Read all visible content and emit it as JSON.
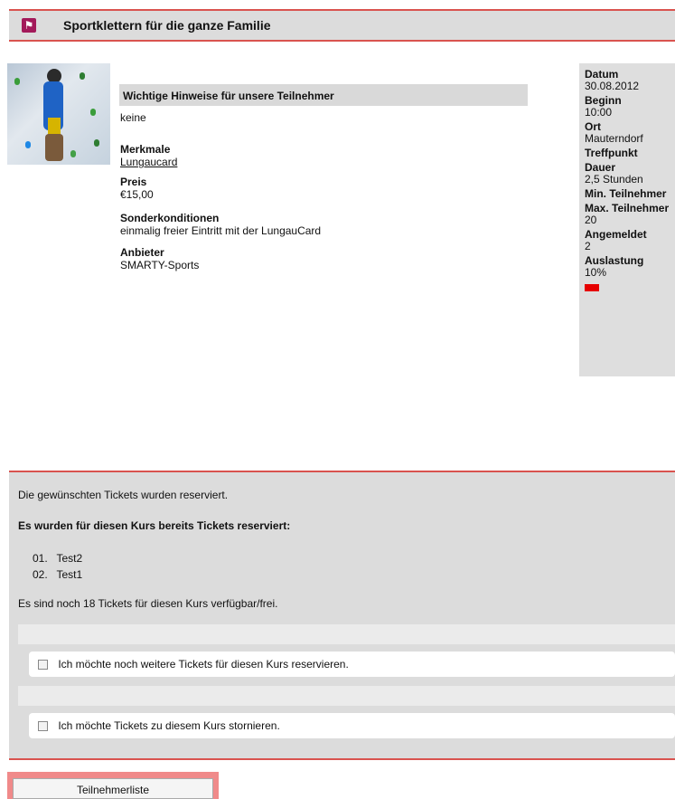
{
  "header": {
    "title": "Sportklettern für die ganze Familie",
    "logo_icon": "climbing-icon"
  },
  "details": {
    "notes_heading": "Wichtige Hinweise für unsere Teilnehmer",
    "notes_value": "keine",
    "features_label": "Merkmale",
    "features_link": "Lungaucard",
    "price_label": "Preis",
    "price_value": "€15,00",
    "conditions_label": "Sonderkonditionen",
    "conditions_value": "einmalig freier Eintritt mit der LungauCard",
    "provider_label": "Anbieter",
    "provider_value": "SMARTY-Sports"
  },
  "sidebar": {
    "date_label": "Datum",
    "date_value": "30.08.2012",
    "start_label": "Beginn",
    "start_value": "10:00",
    "place_label": "Ort",
    "place_value": "Mauterndorf",
    "meeting_label": "Treffpunkt",
    "duration_label": "Dauer",
    "duration_value": "2,5 Stunden",
    "min_label": "Min. Teilnehmer",
    "max_label": "Max. Teilnehmer",
    "max_value": "20",
    "registered_label": "Angemeldet",
    "registered_value": "2",
    "utilization_label": "Auslastung",
    "utilization_value": "10%",
    "utilization_color": "#e60000"
  },
  "reservation": {
    "message": "Die gewünschten Tickets wurden reserviert.",
    "already_heading": "Es wurden für diesen Kurs bereits Tickets reserviert:",
    "items": [
      {
        "num": "01.",
        "name": "Test2"
      },
      {
        "num": "02.",
        "name": "Test1"
      }
    ],
    "available": "Es sind noch 18 Tickets für diesen Kurs verfügbar/frei.",
    "more_checkbox": "Ich möchte noch weitere Tickets für diesen Kurs reservieren.",
    "cancel_checkbox": "Ich möchte Tickets zu diesem Kurs stornieren."
  },
  "actions": {
    "participants_button": "Teilnehmerliste"
  }
}
